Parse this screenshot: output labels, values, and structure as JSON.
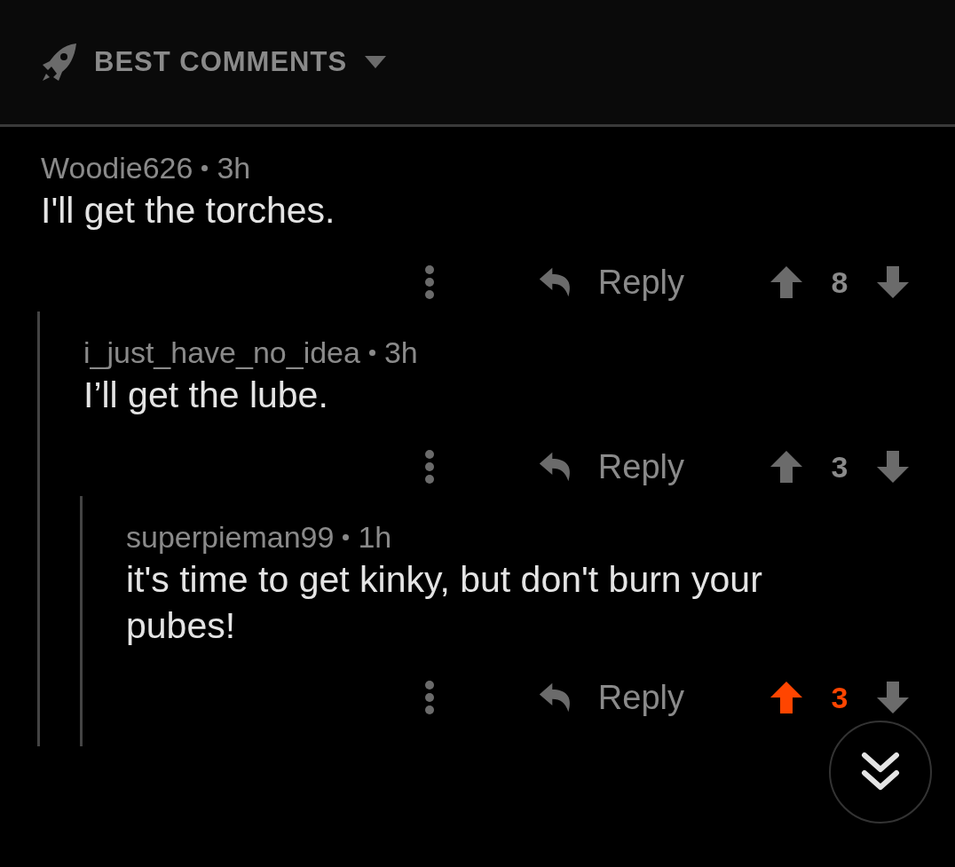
{
  "sort": {
    "label": "BEST COMMENTS"
  },
  "comments": [
    {
      "author": "Woodie626",
      "age": "3h",
      "body": "I'll get the torches.",
      "reply": "Reply",
      "score": "8",
      "upvoted": false,
      "children": [
        {
          "author": "i_just_have_no_idea",
          "age": "3h",
          "body": "I’ll get the lube.",
          "reply": "Reply",
          "score": "3",
          "upvoted": false,
          "children": [
            {
              "author": "superpieman99",
              "age": "1h",
              "body": "it's time to get kinky, but don't burn your pubes!",
              "reply": "Reply",
              "score": "3",
              "upvoted": true
            }
          ]
        }
      ]
    }
  ]
}
